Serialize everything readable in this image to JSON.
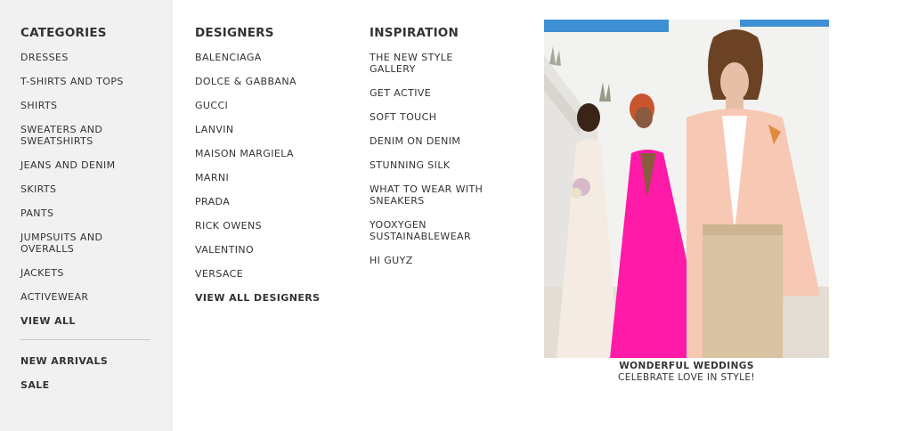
{
  "categories": {
    "heading": "CATEGORIES",
    "items": [
      {
        "label": "DRESSES"
      },
      {
        "label": "T-SHIRTS AND TOPS"
      },
      {
        "label": "SHIRTS"
      },
      {
        "label": "SWEATERS AND\nSWEATSHIRTS"
      },
      {
        "label": "JEANS AND DENIM"
      },
      {
        "label": "SKIRTS"
      },
      {
        "label": "PANTS"
      },
      {
        "label": "JUMPSUITS AND\nOVERALLS"
      },
      {
        "label": "JACKETS"
      },
      {
        "label": "ACTIVEWEAR"
      }
    ],
    "view_all": "VIEW ALL",
    "extra": [
      {
        "label": "NEW ARRIVALS"
      },
      {
        "label": "SALE"
      }
    ]
  },
  "designers": {
    "heading": "DESIGNERS",
    "items": [
      {
        "label": "BALENCIAGA"
      },
      {
        "label": "DOLCE & GABBANA"
      },
      {
        "label": "GUCCI"
      },
      {
        "label": "LANVIN"
      },
      {
        "label": "MAISON MARGIELA"
      },
      {
        "label": "MARNI"
      },
      {
        "label": "PRADA"
      },
      {
        "label": "RICK OWENS"
      },
      {
        "label": "VALENTINO"
      },
      {
        "label": "VERSACE"
      }
    ],
    "view_all": "VIEW ALL DESIGNERS"
  },
  "inspiration": {
    "heading": "INSPIRATION",
    "items": [
      {
        "label": "THE NEW STYLE\nGALLERY"
      },
      {
        "label": "GET ACTIVE"
      },
      {
        "label": "SOFT TOUCH"
      },
      {
        "label": "DENIM ON DENIM"
      },
      {
        "label": "STUNNING SILK"
      },
      {
        "label": "WHAT TO WEAR WITH\nSNEAKERS"
      },
      {
        "label": "YOOXYGEN\nSUSTAINABLEWEAR"
      },
      {
        "label": "HI GUYZ"
      }
    ]
  },
  "promo": {
    "title": "WONDERFUL WEDDINGS",
    "subtitle": "CELEBRATE LOVE IN STYLE!",
    "image_icon": "fashion-photo",
    "colors": {
      "sky": "#3f8fd4",
      "wall": "#f2f2f0",
      "pink_dress": "#ff1aa8",
      "blazer": "#f7c8b4",
      "cream_dress": "#f4ece2",
      "trousers": "#d9c3a3"
    }
  }
}
